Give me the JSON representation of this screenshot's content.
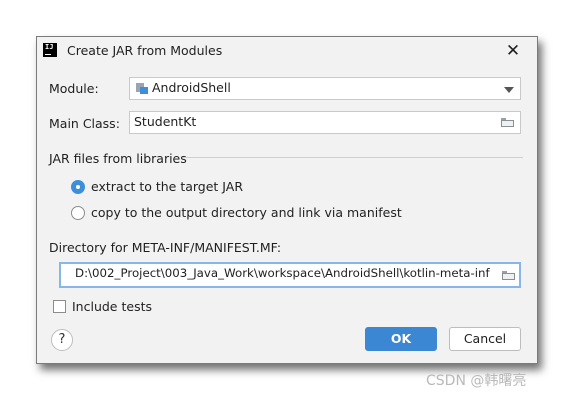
{
  "dialog": {
    "title": "Create JAR from Modules",
    "app_icon_text": "IJ"
  },
  "module": {
    "label": "Module:",
    "value": "AndroidShell"
  },
  "main_class": {
    "label": "Main Class:",
    "value": "StudentKt"
  },
  "jar_files": {
    "section_label": "JAR files from libraries",
    "options": [
      {
        "label": "extract to the target JAR",
        "selected": true
      },
      {
        "label": "copy to the output directory and link via manifest",
        "selected": false
      }
    ]
  },
  "manifest": {
    "label": "Directory for META-INF/MANIFEST.MF:",
    "value": "D:\\002_Project\\003_Java_Work\\workspace\\AndroidShell\\kotlin-meta-inf"
  },
  "include_tests": {
    "label": "Include tests",
    "checked": false
  },
  "buttons": {
    "help": "?",
    "ok": "OK",
    "cancel": "Cancel"
  },
  "watermark": "CSDN @韩曙亮",
  "colors": {
    "accent": "#3b87d4",
    "dialog_bg": "#f2f2f2",
    "focus_border": "#86b6ea"
  }
}
